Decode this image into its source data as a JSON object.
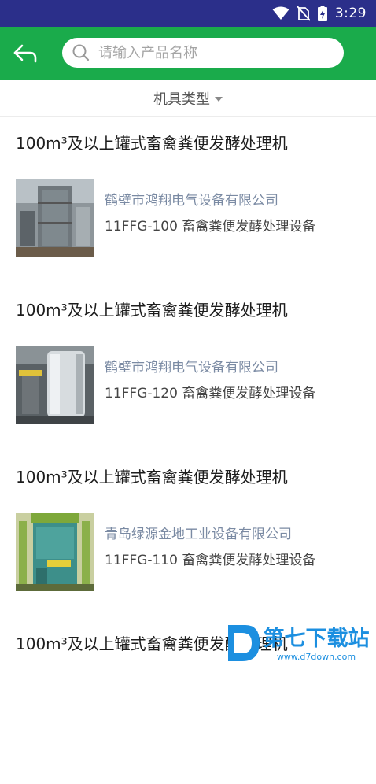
{
  "status": {
    "time": "3:29"
  },
  "search": {
    "placeholder": "请输入产品名称"
  },
  "filter": {
    "label": "机具类型"
  },
  "items": [
    {
      "title": "100m³及以上罐式畜禽粪便发酵处理机",
      "company": "鹤壁市鸿翔电气设备有限公司",
      "model": "11FFG-100 畜禽粪便发酵处理设备"
    },
    {
      "title": "100m³及以上罐式畜禽粪便发酵处理机",
      "company": "鹤壁市鸿翔电气设备有限公司",
      "model": "11FFG-120 畜禽粪便发酵处理设备"
    },
    {
      "title": "100m³及以上罐式畜禽粪便发酵处理机",
      "company": "青岛绿源金地工业设备有限公司",
      "model": "11FFG-110 畜禽粪便发酵处理设备"
    },
    {
      "title": "100m³及以上罐式畜禽粪便发酵处理机"
    }
  ],
  "watermark": {
    "brand": "第七下载站",
    "url": "www.d7down.com"
  },
  "colors": {
    "status_bar": "#2b2f8a",
    "app_bar": "#1aab4b",
    "company_text": "#7a8aa3"
  }
}
